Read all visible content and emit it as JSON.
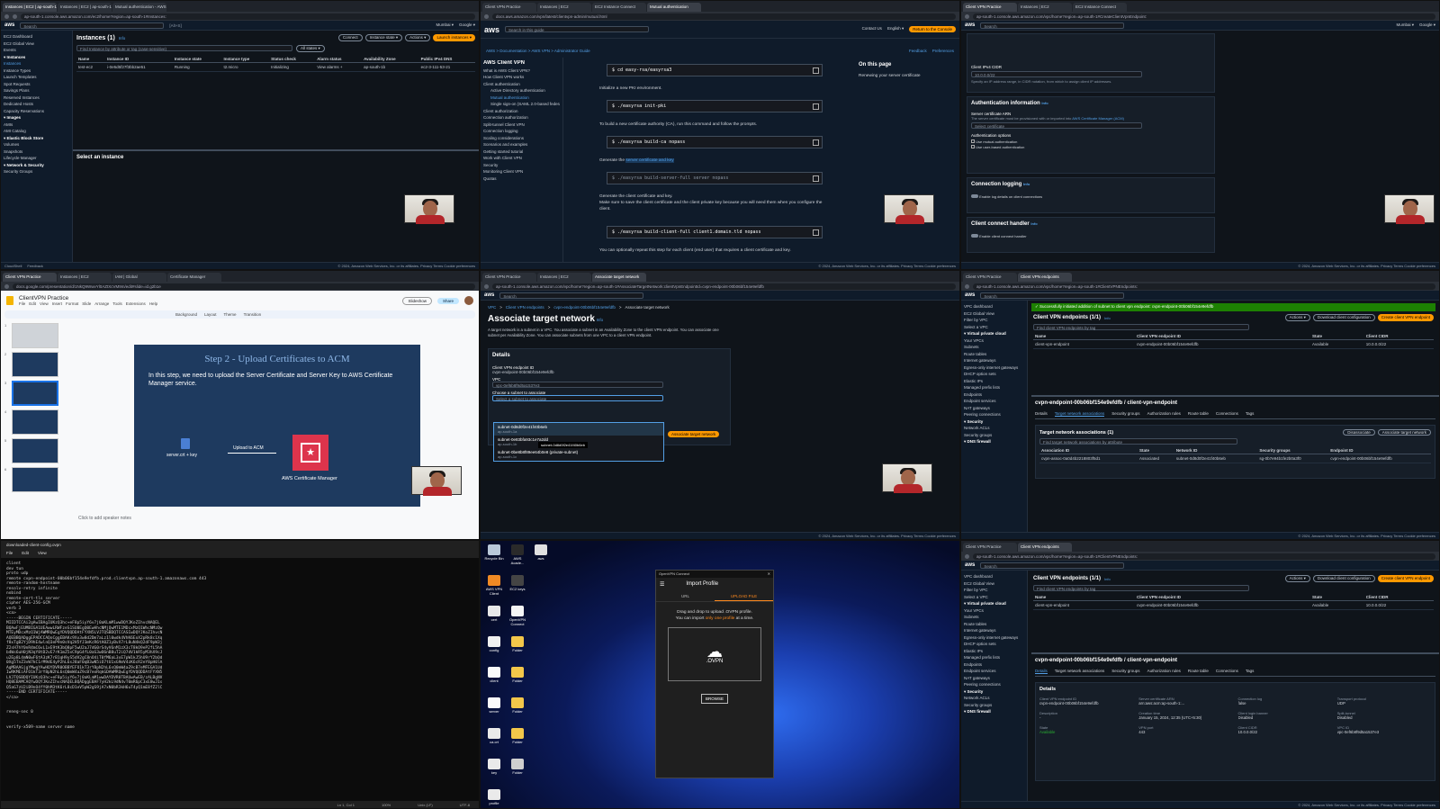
{
  "p1": {
    "tabs": [
      "Instances | EC2 | ap-south-1",
      "Instances | EC2 | ap-south-1",
      "Mutual authentication - AWS C..."
    ],
    "url": "ap-south-1.console.aws.amazon.com/ec2/home?region=ap-south-1#Instances:",
    "search": "Search",
    "shortcut": "[Alt+S]",
    "nav_right": [
      "Mumbai ▾",
      "Google ▾"
    ],
    "sidebar": [
      "EC2 Dashboard",
      "EC2 Global View",
      "Events",
      "▾ Instances",
      "Instances",
      "Instance Types",
      "Launch Templates",
      "Spot Requests",
      "Savings Plans",
      "Reserved Instances",
      "Dedicated Hosts",
      "Capacity Reservations",
      "▾ Images",
      "AMIs",
      "AMI Catalog",
      "▾ Elastic Block Store",
      "Volumes",
      "Snapshots",
      "Lifecycle Manager",
      "▾ Network & Security",
      "Security Groups"
    ],
    "title": "Instances (1)",
    "info": "Info",
    "buttons": [
      "Connect",
      "Instance state ▾",
      "Actions ▾",
      "Launch instances ▾"
    ],
    "filter": "Find Instance by attribute or tag (case-sensitive)",
    "filter_opt": "All states ▾",
    "columns": [
      "Name",
      "Instance ID",
      "Instance state",
      "Instance type",
      "Status check",
      "Alarm status",
      "Availability Zone",
      "Public IPv4 DNS"
    ],
    "row": [
      "test-ec2",
      "i-0e5d5f27f3bb2ae51",
      "Running",
      "t2.micro",
      "Initializing",
      "View alarms +",
      "ap-south-1b",
      "ec2-3-111-53-21"
    ],
    "bottom": "Select an instance",
    "footer": [
      "CloudShell",
      "Feedback"
    ],
    "footer_right": "© 2024, Amazon Web Services, Inc. or its affiliates.   Privacy   Terms   Cookie preferences"
  },
  "p2": {
    "url": "docs.aws.amazon.com/vpn/latest/clientvpn-admin/mutual.html",
    "search": "Search in this guide",
    "nav": [
      "Contact Us",
      "English ▾"
    ],
    "console_btn": "Return to the Console",
    "breadcrumb": "AWS  >  Documentation  >  AWS VPN  >  Administrator Guide",
    "feedback": "Feedback",
    "prefs": "Preferences",
    "side_title": "AWS Client VPN",
    "side_items": [
      "What is AWS Client VPN?",
      "How Client VPN works",
      "Client authentication",
      "Active Directory authentication",
      "Mutual authentication",
      "Single sign-on (SAML 2.0-based federated authentication)",
      "Client authorization",
      "Connection authorization",
      "Split-tunnel Client VPN",
      "Connection logging",
      "Scaling considerations",
      "Scenarios and examples",
      "Getting started tutorial",
      "Work with Client VPN",
      "Security",
      "Monitoring Client VPN",
      "Quotas"
    ],
    "cmd1": "$ cd easy-rsa/easyrsa3",
    "step2": "Initialize a new PKI environment.",
    "cmd2": "$ ./easyrsa init-pki",
    "step3": "To build a new certificate authority (CA), run this command and follow the prompts.",
    "cmd3": "$ ./easyrsa build-ca nopass",
    "step4a": "Generate the",
    "step4link": "server certificate and key",
    "cmd4": "$ ./easyrsa build-server-full server nopass",
    "step5": "Generate the client certificate and key.",
    "step5b": "Make sure to save the client certificate and the client private key because you will need them when you configure the client.",
    "cmd5": "$ ./easyrsa build-client-full client1.domain.tld nopass",
    "step5c": "You can optionally repeat this step for each client (end user) that requires a client certificate and key.",
    "on_page": "On this page",
    "on_page_item": "Renewing your server certificate",
    "footer_right": "© 2024, Amazon Web Services, Inc. or its affiliates.   Privacy   Terms   Cookie preferences"
  },
  "p3": {
    "url": "ap-south-1.console.aws.amazon.com/vpc/home?region=ap-south-1#CreateClientVpnEndpoint:",
    "search": "Search",
    "nav_right": [
      "Mumbai ▾",
      "Google ▾"
    ],
    "f1": "Client IPv4 CIDR",
    "f1_val": "10.0.0.0/22",
    "f1_help": "Specify an IP address range, in CIDR notation, from which to assign client IP addresses.",
    "auth_title": "Authentication information",
    "cert_label": "Server certificate ARN",
    "cert_help": "The server certificate must be provisioned with or imported into",
    "cert_link": "AWS Certificate Manager (ACM)",
    "cert_select": "Select certificate",
    "auth_opts": "Authentication options",
    "opt1": "Use mutual authentication",
    "opt2": "Use user-based authentication",
    "log_title": "Connection logging",
    "log_item": "Enable log details on client connections",
    "handler_title": "Client connect handler",
    "handler_item": "Enable client connect handler",
    "info": "Info",
    "footer_right": "© 2024, Amazon Web Services, Inc. or its affiliates.   Privacy   Terms   Cookie preferences"
  },
  "p4": {
    "url": "docs.google.com/presentation/d/1NkQ9WwvYl0AZtXcVM9m/edit#slide=id.g2b1e",
    "title": "ClientVPN Practice",
    "menus": [
      "File",
      "Edit",
      "View",
      "Insert",
      "Format",
      "Slide",
      "Arrange",
      "Tools",
      "Extensions",
      "Help"
    ],
    "slideshow": "Slideshow",
    "share": "Share",
    "toolbar": [
      "Background",
      "Layout",
      "Theme",
      "Transition"
    ],
    "slide_title": "Step 2 - Upload Certificates to ACM",
    "slide_body": "In this step, we need to upload the Server Certificate and Server Key to AWS Certificate Manager service.",
    "doc_label": "server.crt + key",
    "arrow_label": "Upload to ACM",
    "acm_label": "AWS Certificate Manager",
    "notes": "Click to add speaker notes",
    "slide_nums": [
      "1",
      "2",
      "3",
      "4",
      "5",
      "6"
    ]
  },
  "p5": {
    "url": "ap-south-1.console.aws.amazon.com/vpc/home?region=ap-south-1#AssociateTargetNetwork:clientVpnEndpointId=cvpn-endpoint-00b06bf154e9efdfb",
    "search": "Search",
    "breadcrumb": [
      "VPC",
      "Client VPN endpoints",
      "cvpn-endpoint-00b06bf154e9efdfb",
      "Associate target network"
    ],
    "title": "Associate target network",
    "info": "Info",
    "desc": "A target network is a subnet in a VPC. You associate a subnet in an Availability Zone to the client VPN endpoint. You can associate one subnet per Availability Zone. You can associate subnets from one VPC to a client VPN endpoint.",
    "details": "Details",
    "ep_label": "Client VPN endpoint ID",
    "ep_val": "cvpn-endpoint-00b06bf154e9efdfb",
    "vpc_label": "VPC",
    "vpc_val": "vpc-0ef6b8f9d5a1537e3",
    "subnet_label": "Choose a subnet to associate",
    "subnet_ph": "Select a subnet to associate",
    "options": [
      "subnet-0d8d0f2e41f40b6eb",
      "subnet-0e83bfa93c1e7a2dd",
      "subnet-0be8b8f89ee64b0e8 (private-subnet)"
    ],
    "opt_sub": [
      "ap-south-1a",
      "ap-south-1b",
      "ap-south-1c"
    ],
    "tooltip": "subnet-0d8d0f2e41f40b6eb",
    "submit": "Associate target network",
    "footer_right": "© 2024, Amazon Web Services, Inc. or its affiliates.   Privacy   Terms   Cookie preferences"
  },
  "p6": {
    "url": "ap-south-1.console.aws.amazon.com/vpc/home?region=ap-south-1#ClientVPNEndpoints:",
    "search": "Search",
    "sidebar": [
      "VPC dashboard",
      "EC2 Global View",
      "Filter by VPC",
      "Select a VPC",
      "▾ Virtual private cloud",
      "Your VPCs",
      "Subnets",
      "Route tables",
      "Internet gateways",
      "Egress-only internet gateways",
      "DHCP option sets",
      "Elastic IPs",
      "Managed prefix lists",
      "Endpoints",
      "Endpoint services",
      "NAT gateways",
      "Peering connections",
      "▾ Security",
      "Network ACLs",
      "Security groups",
      "▾ DNS firewall"
    ],
    "banner": "Successfully initiated addition of subnet to client vpn endpoint: cvpn-endpoint-00b06bf154e9efdfb",
    "title": "Client VPN endpoints (1/1)",
    "info": "Info",
    "buttons": [
      "Actions ▾",
      "Download client configuration",
      "Create client VPN endpoint"
    ],
    "filter": "Find client VPN endpoints by tag",
    "columns": [
      "Name",
      "Client VPN endpoint ID",
      "State",
      "Client CIDR"
    ],
    "row": [
      "client-vpn-endpoint",
      "cvpn-endpoint-00b06bf154e9efdfb",
      "Available",
      "10.0.0.0/22"
    ],
    "detail_title": "cvpn-endpoint-00b06bf154e9efdfb / client-vpn-endpoint",
    "tabs": [
      "Details",
      "Target network associations",
      "Security groups",
      "Authorization rules",
      "Route table",
      "Connections",
      "Tags"
    ],
    "assoc_title": "Target network associations (1)",
    "assoc_btns": [
      "Disassociate",
      "Associate target network"
    ],
    "assoc_filter": "Find target network associations by attribute",
    "assoc_cols": [
      "Association ID",
      "State",
      "Network ID",
      "Security groups",
      "Endpoint ID"
    ],
    "assoc_row": [
      "cvpn-assoc-0a0d4b2218803f5d1",
      "Associated",
      "subnet-0d8d0f2e41f40b6eb",
      "sg-0b7e94b1fe2b0a3f0",
      "cvpn-endpoint-00b06bf154e9efdfb"
    ],
    "footer_right": "© 2024, Amazon Web Services, Inc. or its affiliates.   Privacy   Terms   Cookie preferences"
  },
  "p7": {
    "title": "downloaded-client-config.ovpn",
    "menus": [
      "File",
      "Edit",
      "View"
    ],
    "text": "client\ndev tun\nproto udp\nremote cvpn-endpoint-00b06bf154e9efdfb.prod.clientvpn.ap-south-1.amazonaws.com 443\nremote-random-hostname\nresolv-retry infinite\nnobind\nremote-cert-tls server\ncipher AES-256-GCM\nverb 3\n<ca>\n-----BEGIN CERTIFICATE-----\nMIIDTCCAi2gAwIBAgIUKzQ3hc+eF8p5iyY6v7j0aKLmM1wwDQYJKoZIhvcNAQEL\nBQAwFjEUMBIGA1UEAwwLRWFzeS1SU0EgQ0EwHhcNMjQwMTE1MDcxMzQ1WhcNMzQw\nMTEyMDcxMzQ1WjAWMRQwEgYDVQQDDAtFYXN5LVJTQSBDQTCCASIwDQYJKoZIhvcN\nAQEBBQADggEPADCCAQoCggEBAKc9Xx3w8d2Dm7aLz1l0wdk4VhK6EoX2pRk8c1Xq\nf8xTgB2YjD9hE4wlnQ3eP9n0sVq2H5fJ3mKcR6tA0Z1yBvX7rL8uN4kQ2dF9pW3j\nZ2sH7hY0nR4mC6vL1xE9tK3bQ8pF5wU2aJ7dG0rS4yV6nM1zX3cT8kO9eP2fL5hA\nb4Ws6uH0jN3qY8tD2vE7rK1mZ5xC9pG4fL0aS3wO6nB8uT2iQ7dV1kR5yM3hX9cJ\nu2Ep8L4mN0wF6tA3zK7rB1qH9yS5dV2gC8nO4iT0fM6aL3xE7pW1kJ5hU9rY2bQd\n0Xg5TnZ3vW7kC1rM9dE4yP2hL6sJ8aF0qB3wN5iO7tU1xG9mV4zK6cR2eY8pH0lA\nAgMBAAGjgYMwgYAwHQYDVR0OBBYEFO1kT3rY8pN2hL6sQ0mW4aZ9cB7eMFEGA1Ud\nIwRKMEiAFO1kT3rY8pN2hL6sQ0mW4aZ9cB7eoRqkGDAWMRQwEgYDVQQDDAtFYXN5\nLVJTQSBDQYIUKzQ3hc+eF8p5iyY6v7j0aKLmM1wwDAYDVR0TBAUwAwEB/zALBgNV\nHQ8EBAMCAQYwDQYJKoZIhvcNAQELBQADggEBAF7yH2kL9dN4vT0mR6pC3xE8wJ1s\nQ5aG7zU2iB9nO4fY0hM3tK6rL8cD1eV5pW2gS9jA7xN0bR3kH6uT4yQ1mE8fZ2lC\n-----END CERTIFICATE-----\n</ca>\n\n\nreneg-sec 0\n\n\nverify-x509-name server name",
    "status": [
      "Ln 1, Col 1",
      "100%",
      "Unix (LF)",
      "UTF-8"
    ]
  },
  "p8": {
    "desktop_icons": [
      [
        "Recycle Bin",
        "#b9c8d8"
      ],
      [
        "AWS Acade...",
        "#2a2a2a"
      ],
      [
        "aws",
        "#e0e0e0"
      ],
      [
        "AWS VPN Client",
        "#f08a24"
      ],
      [
        "EC2 keys",
        "#444"
      ],
      [
        "cert",
        "#e8e8e8"
      ],
      [
        "OpenVPN Connect",
        "#f5f5f5"
      ],
      [
        "config",
        "#f0f0f0"
      ],
      [
        "Folder",
        "#f3c74a"
      ],
      [
        "client",
        "#fafafa"
      ],
      [
        "Folder",
        "#f3c74a"
      ],
      [
        "server",
        "#fafafa"
      ],
      [
        "Folder",
        "#f3c74a"
      ],
      [
        "ca.crt",
        "#eaeaea"
      ],
      [
        "Folder",
        "#f3c74a"
      ],
      [
        "key",
        "#eaeaea"
      ],
      [
        "Folder",
        "#cfcfcf"
      ],
      [
        "profile",
        "#eaeaea"
      ]
    ],
    "app_title": "OpenVPN Connect",
    "header": "Import Profile",
    "tabs": [
      "URL",
      "UPLOAD FILE"
    ],
    "drag_text": "Drag and drop to upload .OVPN profile.",
    "drag_text2a": "You can import",
    "drag_link": "only one profile",
    "drag_text2b": "at a time.",
    "ovpn": ".OVPN",
    "browse": "BROWSE"
  },
  "p9": {
    "url": "ap-south-1.console.aws.amazon.com/vpc/home?region=ap-south-1#ClientVPNEndpoints:",
    "search": "Search",
    "sidebar": [
      "VPC dashboard",
      "EC2 Global View",
      "Filter by VPC",
      "Select a VPC",
      "▾ Virtual private cloud",
      "Your VPCs",
      "Subnets",
      "Route tables",
      "Internet gateways",
      "Egress-only internet gateways",
      "DHCP option sets",
      "Elastic IPs",
      "Managed prefix lists",
      "Endpoints",
      "Endpoint services",
      "NAT gateways",
      "Peering connections",
      "▾ Security",
      "Network ACLs",
      "Security groups",
      "▾ DNS firewall"
    ],
    "title": "Client VPN endpoints (1/1)",
    "info": "Info",
    "buttons": [
      "Actions ▾",
      "Download client configuration",
      "Create client VPN endpoint"
    ],
    "filter": "Find client VPN endpoints by tag",
    "columns": [
      "Name",
      "Client VPN endpoint ID",
      "State",
      "Client CIDR"
    ],
    "row": [
      "client-vpn-endpoint",
      "cvpn-endpoint-00b06bf154e9efdfb",
      "Available",
      "10.0.0.0/22"
    ],
    "detail_title": "cvpn-endpoint-00b06bf154e9efdfb / client-vpn-endpoint",
    "tabs": [
      "Details",
      "Target network associations",
      "Security groups",
      "Authorization rules",
      "Route table",
      "Connections",
      "Tags"
    ],
    "details": "Details",
    "fields": [
      [
        "Client VPN endpoint ID",
        "cvpn-endpoint-00b06bf154e9efdfb"
      ],
      [
        "Server certificate ARN",
        "arn:aws:acm:ap-south-1:..."
      ],
      [
        "Connection log",
        "false"
      ],
      [
        "Transport protocol",
        "UDP"
      ],
      [
        "Description",
        "-"
      ],
      [
        "Creation time",
        "January 15, 2024, 12:35 (UTC+5:30)"
      ],
      [
        "Client login banner",
        "Disabled"
      ],
      [
        "Split-tunnel",
        "Disabled"
      ],
      [
        "State",
        "Available"
      ],
      [
        "VPN port",
        "443"
      ],
      [
        "Client CIDR",
        "10.0.0.0/22"
      ],
      [
        "VPC ID",
        "vpc-0ef6b8f9d5a1537e3"
      ]
    ],
    "footer_right": "© 2024, Amazon Web Services, Inc. or its affiliates.   Privacy   Terms   Cookie preferences"
  },
  "colors": {
    "aws_orange": "#ff9900",
    "aws_link": "#539fe5",
    "aws_green": "#29ad32",
    "aws_nav": "#0f1b2a"
  }
}
